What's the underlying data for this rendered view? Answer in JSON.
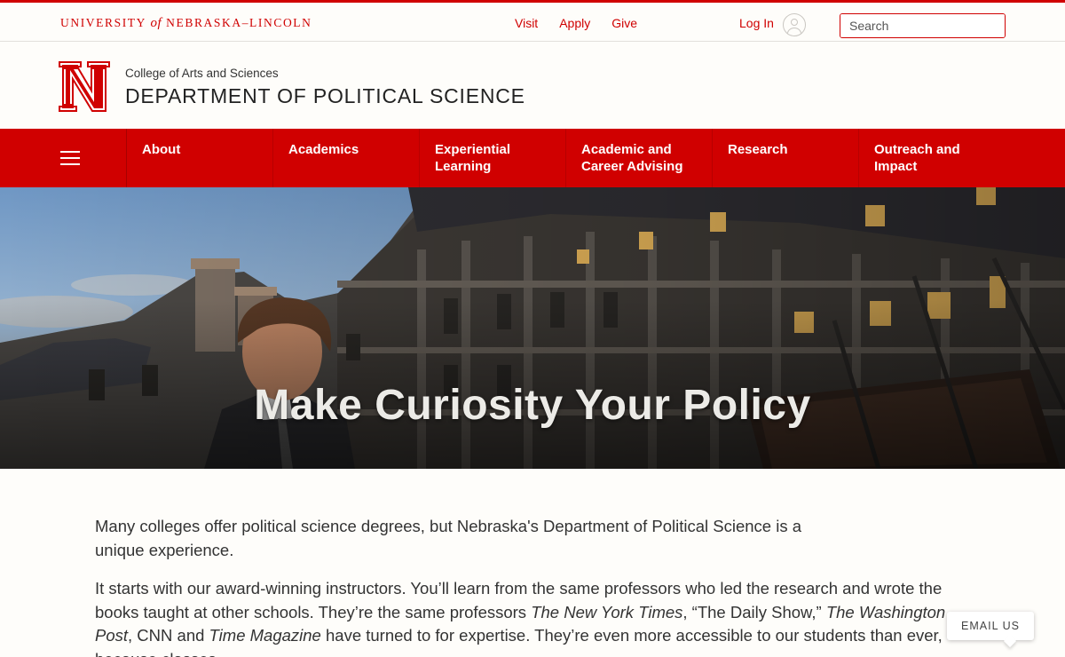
{
  "topbar": {
    "wordmark_pre": "UNIVERSITY",
    "wordmark_of": "of",
    "wordmark_post": "NEBRASKA–LINCOLN",
    "links": [
      "Visit",
      "Apply",
      "Give"
    ],
    "login_label": "Log In",
    "search_placeholder": "Search"
  },
  "header": {
    "college": "College of Arts and Sciences",
    "department": "DEPARTMENT OF POLITICAL SCIENCE"
  },
  "nav": {
    "menu_icon": "hamburger-menu-icon",
    "items": [
      {
        "label": "About"
      },
      {
        "label": "Academics"
      },
      {
        "label": "Experiential Learning"
      },
      {
        "label": "Academic and Career Advising"
      },
      {
        "label": "Research"
      },
      {
        "label": "Outreach and Impact"
      }
    ]
  },
  "hero": {
    "title": "Make Curiosity Your Policy"
  },
  "content": {
    "p1": "Many colleges offer political science degrees, but Nebraska's Department of Political Science is a unique experience.",
    "p2_a": "It starts with our award-winning instructors. You’ll learn from the same professors who led the research and wrote the books taught at other schools. They’re the same professors ",
    "p2_b": "The New York Times",
    "p2_c": ", “The Daily Show,” ",
    "p2_d": "The Washington Post",
    "p2_e": ", CNN and ",
    "p2_f": "Time Magazine",
    "p2_g": " have turned to for expertise. They’re even more accessible to our students than ever, because classes"
  },
  "floating": {
    "email_label": "EMAIL US"
  },
  "colors": {
    "brand_red": "#d00000",
    "background": "#fefdfa"
  }
}
